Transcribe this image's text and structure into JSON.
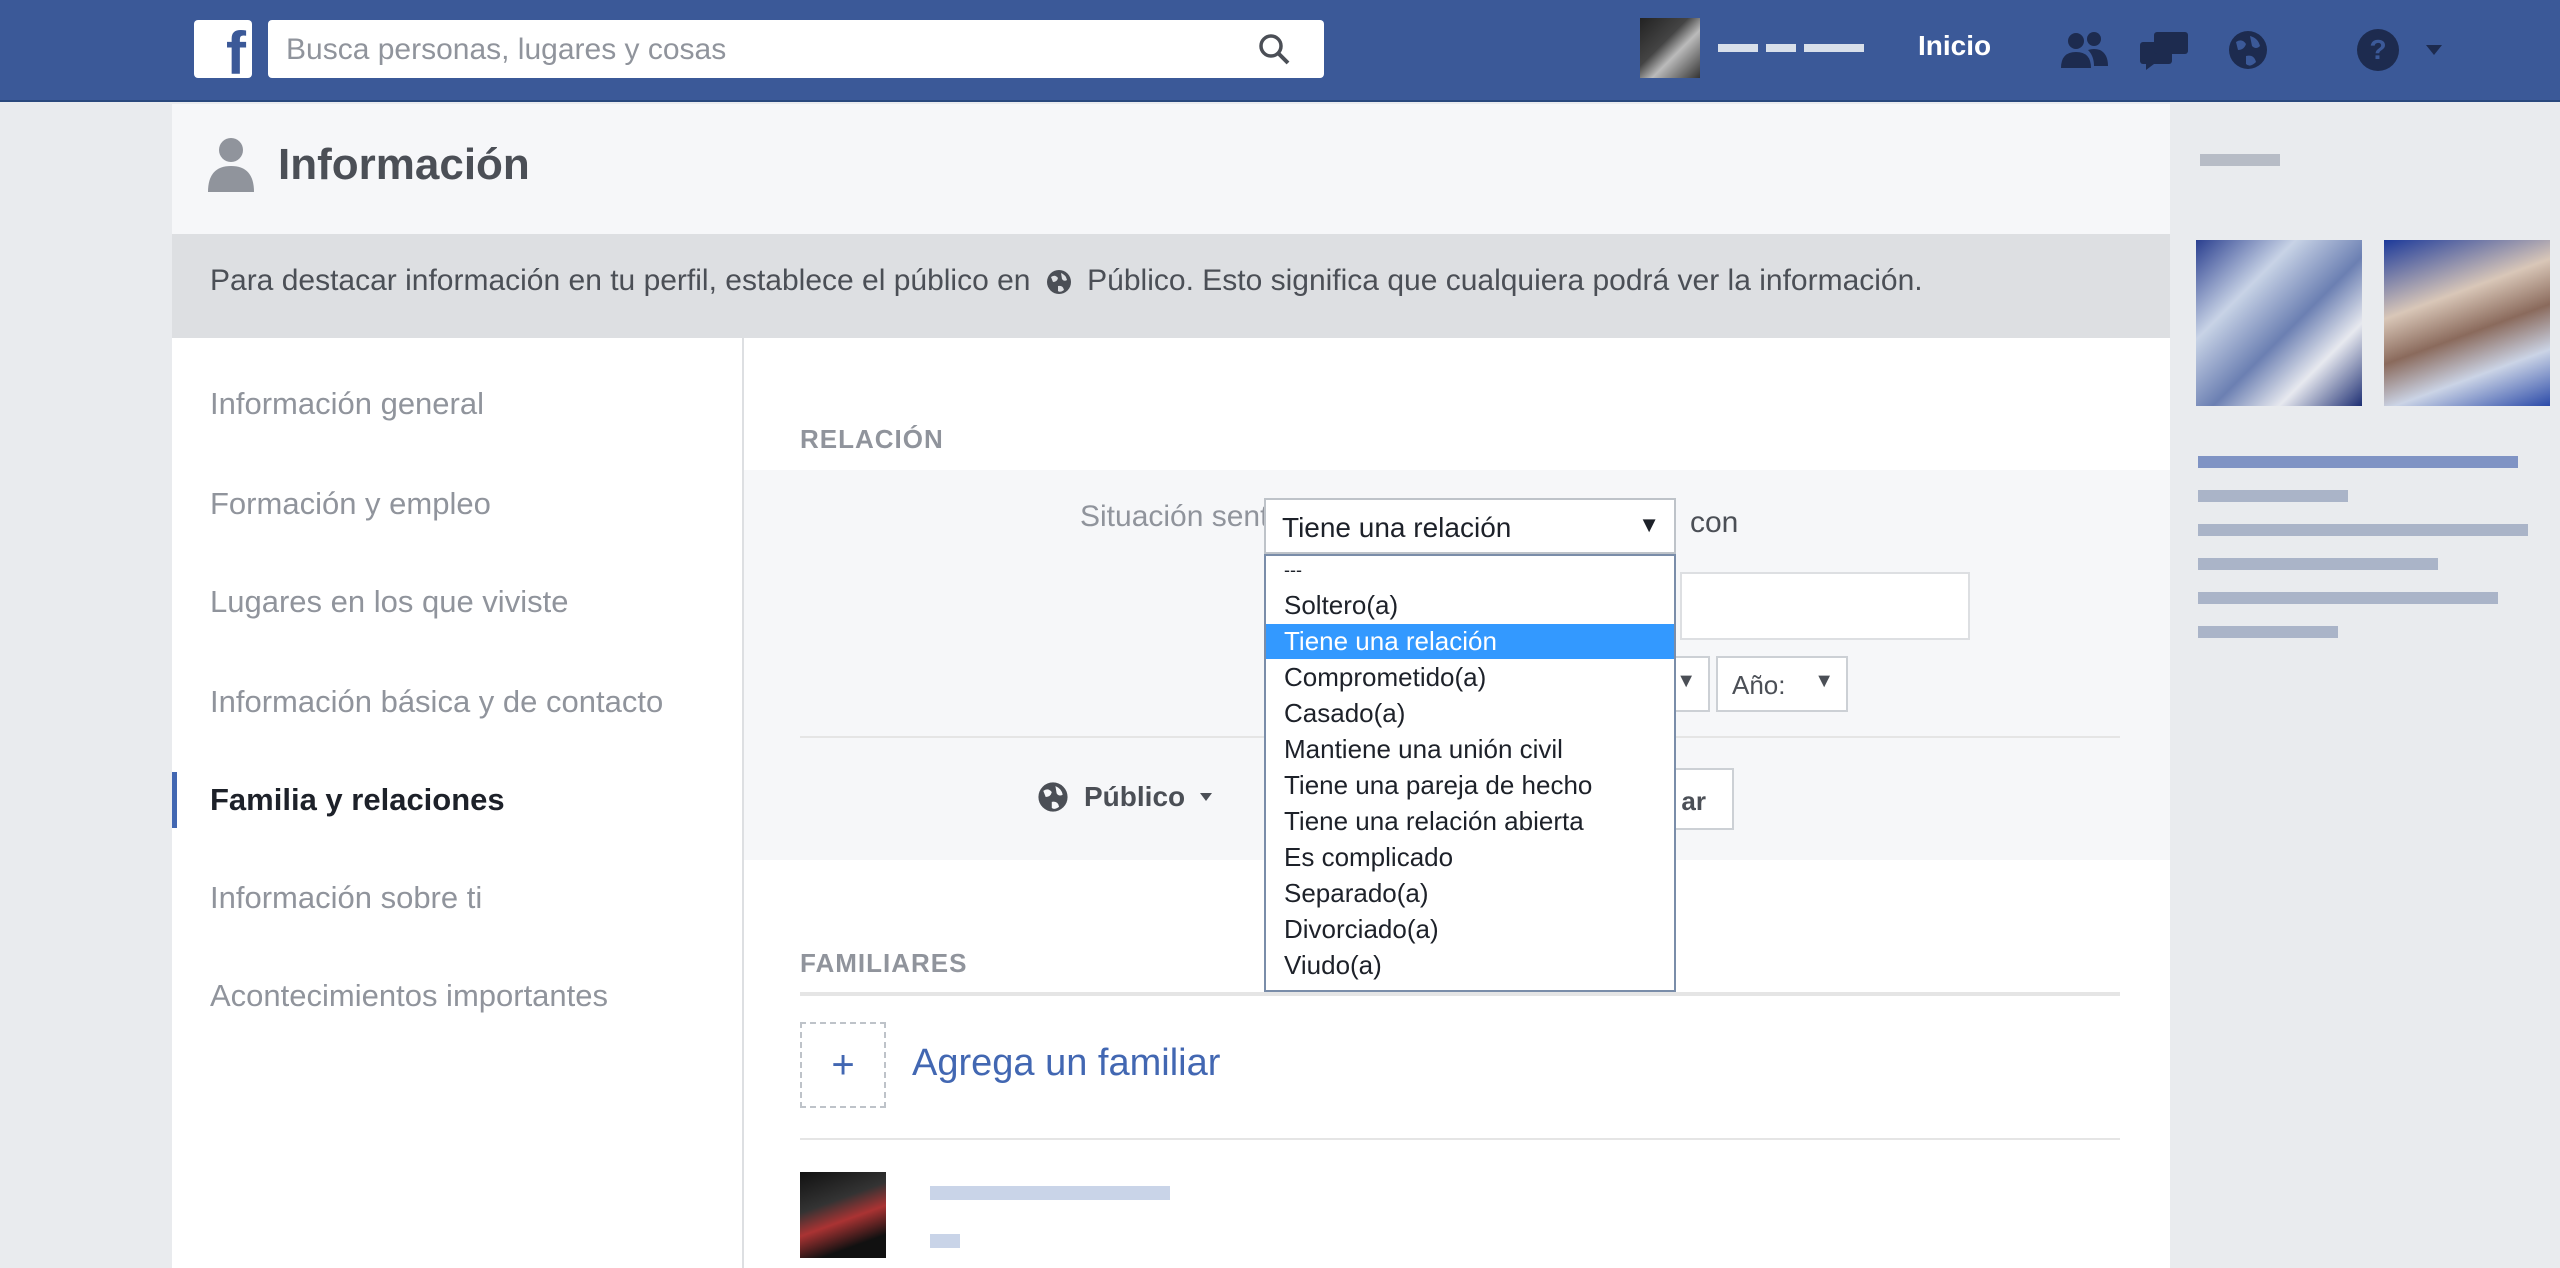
{
  "topbar": {
    "search_placeholder": "Busca personas, lugares y cosas",
    "home_label": "Inicio",
    "icons": [
      "facebook-logo",
      "search-icon",
      "friends-icon",
      "messages-icon",
      "globe-icon",
      "help-icon",
      "caret-down-icon"
    ]
  },
  "page": {
    "title": "Información",
    "notice_prefix": "Para destacar información en tu perfil, establece el público en",
    "notice_suffix": "Público. Esto significa que cualquiera podrá ver la información."
  },
  "nav": {
    "items": [
      {
        "label": "Información general",
        "active": false
      },
      {
        "label": "Formación y empleo",
        "active": false
      },
      {
        "label": "Lugares en los que viviste",
        "active": false
      },
      {
        "label": "Información básica y de contacto",
        "active": false
      },
      {
        "label": "Familia y relaciones",
        "active": true
      },
      {
        "label": "Información sobre ti",
        "active": false
      },
      {
        "label": "Acontecimientos importantes",
        "active": false
      }
    ]
  },
  "relationship": {
    "section_label": "RELACIÓN",
    "field_label": "Situación sentimental",
    "selected_value": "Tiene una relación",
    "con_label": "con",
    "year_label": "Año:",
    "privacy_label": "Público",
    "save_label_partial": "ar",
    "options": [
      "---",
      "Soltero(a)",
      "Tiene una relación",
      "Comprometido(a)",
      "Casado(a)",
      "Mantiene una unión civil",
      "Tiene una pareja de hecho",
      "Tiene una relación abierta",
      "Es complicado",
      "Separado(a)",
      "Divorciado(a)",
      "Viudo(a)"
    ],
    "selected_index": 2
  },
  "family": {
    "section_label": "FAMILIARES",
    "add_label": "Agrega un familiar",
    "add_symbol": "+"
  },
  "colors": {
    "topbar": "#3b5998",
    "link": "#4267b2",
    "selection": "#3399ff"
  }
}
